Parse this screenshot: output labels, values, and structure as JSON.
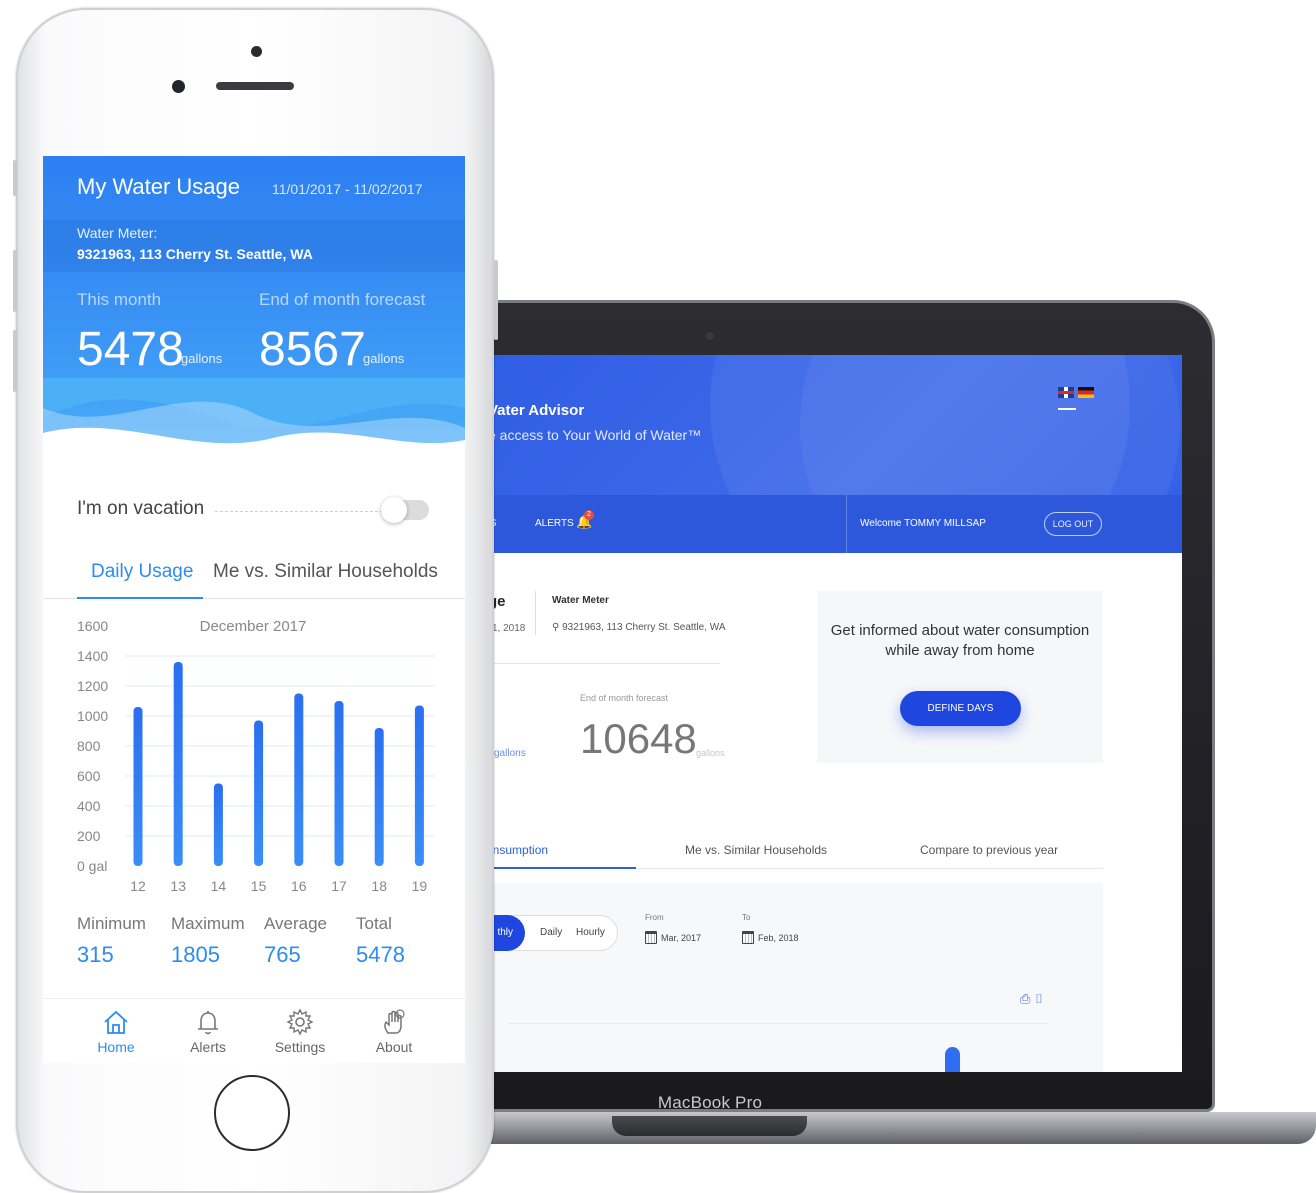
{
  "laptop": {
    "brand": "MacBook Pro",
    "header": {
      "title": "Vater Advisor",
      "subtitle": "e access to Your World of Water™"
    },
    "nav": {
      "settings_tail": "GS",
      "alerts_label": "ALERTS",
      "alerts_badge": "2",
      "welcome": "Welcome TOMMY MILLSAP",
      "logout": "LOG OUT"
    },
    "usage": {
      "title_tail": "ge",
      "date_tail": "1, 2018",
      "meter_label": "Water Meter",
      "meter_address": "9321963, 113 Cherry St. Seattle, WA",
      "forecast_label": "End of month forecast",
      "forecast_value": "10648",
      "forecast_unit": "gallons",
      "gallons_left": "gallons"
    },
    "vacation_card": {
      "text": "Get informed about water consumption while away from home",
      "button": "DEFINE DAYS"
    },
    "tabs": [
      {
        "label": "r Consumption",
        "active": true
      },
      {
        "label": "Me vs. Similar Households",
        "active": false
      },
      {
        "label": "Compare to previous year",
        "active": false
      }
    ],
    "controls": {
      "monthly": "thly",
      "daily": "Daily",
      "hourly": "Hourly",
      "from_label": "From",
      "from_value": "Mar, 2017",
      "to_label": "To",
      "to_value": "Feb, 2018"
    },
    "accent": "#1f47e0"
  },
  "phone": {
    "title": "My Water Usage",
    "date_range": "11/01/2017 - 11/02/2017",
    "meter_label": "Water Meter:",
    "meter_address": "9321963, 113 Cherry St. Seattle, WA",
    "this_month_label": "This month",
    "this_month_value": "5478",
    "forecast_label": "End of month forecast",
    "forecast_value": "8567",
    "unit": "gallons",
    "vacation_label": "I'm on vacation",
    "vacation_on": false,
    "tabs": {
      "daily": "Daily Usage",
      "similar": "Me vs. Similar Households"
    },
    "stats": {
      "min_label": "Minimum",
      "min_value": "315",
      "max_label": "Maximum",
      "max_value": "1805",
      "avg_label": "Average",
      "avg_value": "765",
      "total_label": "Total",
      "total_value": "5478"
    },
    "nav": [
      {
        "label": "Home",
        "icon": "home-icon",
        "active": true
      },
      {
        "label": "Alerts",
        "icon": "bell-icon",
        "active": false
      },
      {
        "label": "Settings",
        "icon": "gear-icon",
        "active": false
      },
      {
        "label": "About",
        "icon": "hand-icon",
        "active": false
      }
    ],
    "accent": "#2d8cf0"
  },
  "chart_data": {
    "type": "bar",
    "title": "December 2017",
    "categories": [
      "12",
      "13",
      "14",
      "15",
      "16",
      "17",
      "18",
      "19"
    ],
    "values": [
      1060,
      1360,
      550,
      970,
      1150,
      1100,
      920,
      1070
    ],
    "ylim": [
      0,
      1600
    ],
    "yticks": [
      "0 gal",
      "200",
      "400",
      "600",
      "800",
      "1000",
      "1200",
      "1400",
      "1600"
    ],
    "grid": true
  }
}
